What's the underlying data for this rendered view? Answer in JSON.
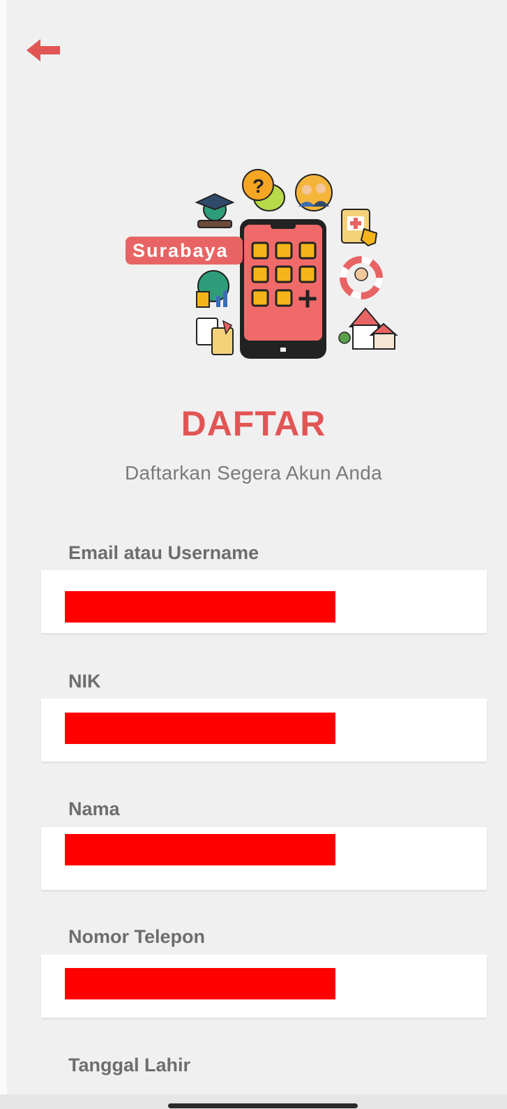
{
  "header": {
    "back_icon": "arrow-left-icon",
    "accent_color": "#e25555"
  },
  "hero": {
    "badge_text": "Surabaya"
  },
  "page": {
    "title": "DAFTAR",
    "subtitle": "Daftarkan Segera Akun Anda"
  },
  "form": {
    "fields": [
      {
        "label": "Email atau Username",
        "value": "[redacted]"
      },
      {
        "label": "NIK",
        "value": "[redacted]"
      },
      {
        "label": "Nama",
        "value": "[redacted]"
      },
      {
        "label": "Nomor Telepon",
        "value": "[redacted]"
      },
      {
        "label": "Tanggal Lahir"
      }
    ]
  }
}
